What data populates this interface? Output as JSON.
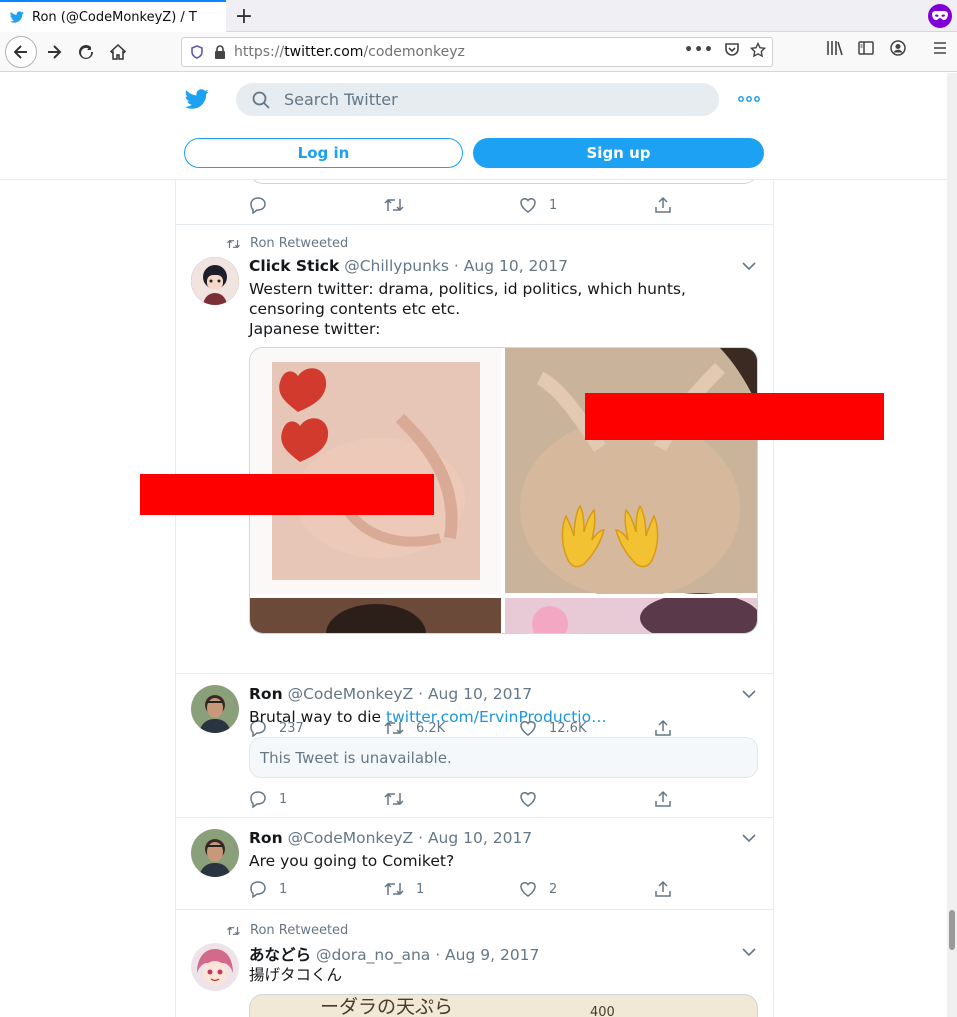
{
  "browser": {
    "tab_title": "Ron (@CodeMonkeyZ) / T",
    "url_proto": "https://",
    "url_host": "twitter.com",
    "url_path": "/codemonkeyz"
  },
  "header": {
    "search_placeholder": "Search Twitter",
    "login_label": "Log in",
    "signup_label": "Sign up"
  },
  "prev_tweet": {
    "likes": "1"
  },
  "tweets": [
    {
      "context": "Ron Retweeted",
      "name": "Click Stick",
      "meta": "@Chillypunks · Aug 10, 2017",
      "text_lines": [
        "Western twitter: drama, politics, id politics, which hunts, censoring contents etc etc.",
        "Japanese twitter:"
      ],
      "replies": "237",
      "retweets": "6.2K",
      "likes": "12.6K"
    },
    {
      "name": "Ron",
      "meta": "@CodeMonkeyZ · Aug 10, 2017",
      "text": "Brutal way to die ",
      "link": "twitter.com/ErvinProductio…",
      "quote": "This Tweet is unavailable.",
      "replies": "1",
      "retweets": "",
      "likes": ""
    },
    {
      "name": "Ron",
      "meta": "@CodeMonkeyZ · Aug 10, 2017",
      "text": "Are you going to Comiket?",
      "replies": "1",
      "retweets": "1",
      "likes": "2"
    },
    {
      "context": "Ron Retweeted",
      "name": "あなどら",
      "meta": "@dora_no_ana · Aug 9, 2017",
      "text": "揚げタコくん",
      "media_text": "ーダラの天ぷら"
    }
  ],
  "colors": {
    "accent": "#1da1f2",
    "muted": "#657786",
    "border": "#e6ecf0",
    "redaction": "#ff0000"
  }
}
